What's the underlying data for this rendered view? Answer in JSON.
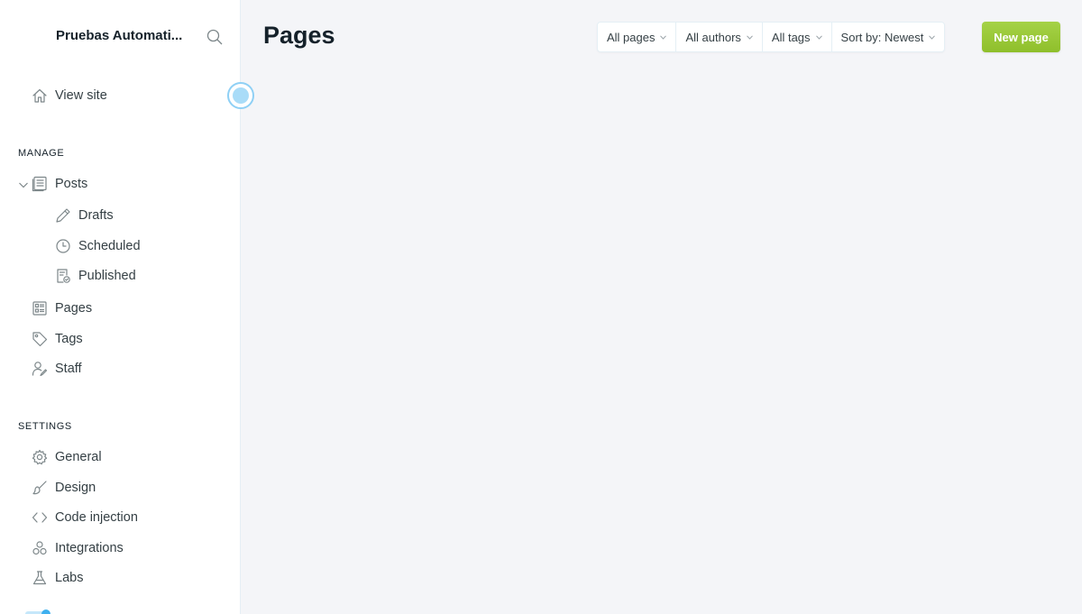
{
  "sidebar": {
    "site_title": "Pruebas Automati...",
    "view_site": "View site",
    "manage_heading": "MANAGE",
    "posts": "Posts",
    "drafts": "Drafts",
    "scheduled": "Scheduled",
    "published": "Published",
    "pages": "Pages",
    "tags": "Tags",
    "staff": "Staff",
    "settings_heading": "SETTINGS",
    "general": "General",
    "design": "Design",
    "code_injection": "Code injection",
    "integrations": "Integrations",
    "labs": "Labs"
  },
  "main": {
    "title": "Pages",
    "filters": {
      "type": "All pages",
      "authors": "All authors",
      "tags": "All tags",
      "sort": "Sort by: Newest"
    },
    "new_button": "New page"
  },
  "colors": {
    "accent": "#9fcc3e",
    "background": "#f4f5f8",
    "sidebar": "#ffffff",
    "pulse": "#a9dcf8"
  }
}
